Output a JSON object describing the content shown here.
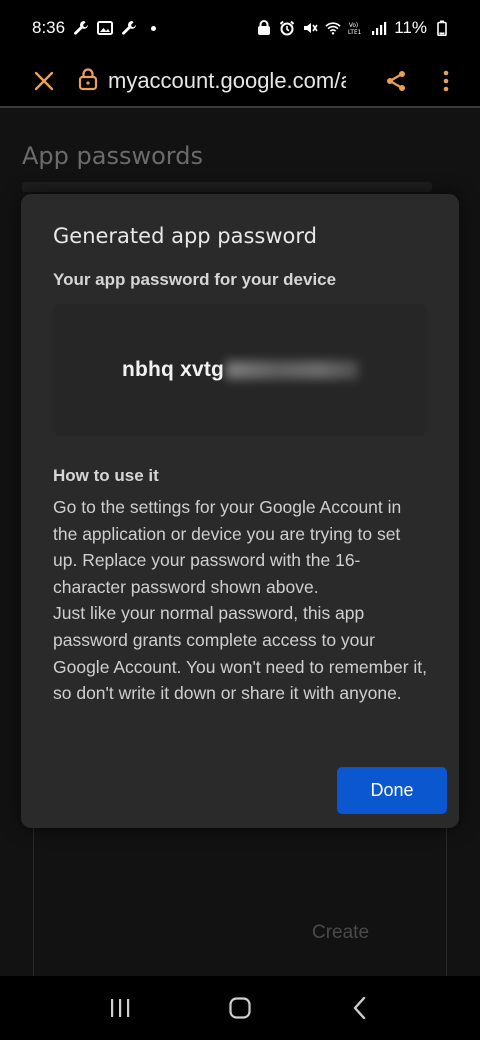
{
  "status_bar": {
    "time": "8:36",
    "battery": "11%",
    "icons": [
      "wrench-icon",
      "image-icon",
      "wrench-icon",
      "notification-dot",
      "alarm-lock-icon",
      "alarm-icon",
      "mute-icon",
      "wifi-icon",
      "volte-icon",
      "signal-icon",
      "battery-icon"
    ]
  },
  "browser": {
    "url": "myaccount.google.com/a",
    "icons": [
      "close-icon",
      "lock-icon",
      "share-icon",
      "more-vert-icon"
    ]
  },
  "page": {
    "title": "App passwords",
    "create_label": "Create"
  },
  "dialog": {
    "title": "Generated app password",
    "password_label": "Your app password for your device",
    "password_visible": "nbhq xvtg",
    "how_to_title": "How to use it",
    "how_to_body_1": "Go to the settings for your Google Account in the application or device you are trying to set up. Replace your password with the 16-character password shown above.",
    "how_to_body_2": "Just like your normal password, this app password grants complete access to your Google Account. You won't need to remember it, so don't write it down or share it with anyone.",
    "done_label": "Done"
  },
  "colors": {
    "accent": "#0b57d0",
    "dialog_bg": "#2a2a2b",
    "page_bg": "#121212"
  },
  "nav": {
    "icons": [
      "recent-apps-icon",
      "home-icon",
      "back-icon"
    ]
  }
}
